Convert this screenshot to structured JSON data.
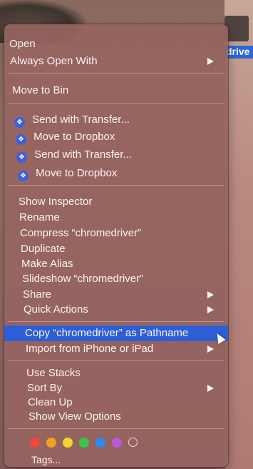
{
  "desktop": {
    "selected_label": "drive"
  },
  "menu": {
    "open": "Open",
    "always_open_with": "Always Open With",
    "move_to_bin": "Move to Bin",
    "dropbox_items": [
      {
        "label": "Send with Transfer..."
      },
      {
        "label": "Move to Dropbox"
      },
      {
        "label": "Send with Transfer..."
      },
      {
        "label": "Move to Dropbox"
      }
    ],
    "show_inspector": "Show Inspector",
    "rename": "Rename",
    "compress": "Compress “chromedriver”",
    "duplicate": "Duplicate",
    "make_alias": "Make Alias",
    "slideshow": "Slideshow “chromedriver”",
    "share": "Share",
    "quick_actions": "Quick Actions",
    "copy_pathname": "Copy “chromedriver” as Pathname",
    "import_iphone": "Import from iPhone or iPad",
    "use_stacks": "Use Stacks",
    "sort_by": "Sort By",
    "clean_up": "Clean Up",
    "show_view_options": "Show View Options",
    "tags_label": "Tags...",
    "tag_colors": [
      "#f0483a",
      "#f4a021",
      "#f6d52b",
      "#37c84a",
      "#2c8bf0",
      "#bc57d8",
      "empty"
    ],
    "highlight_color": "#2c5fd6"
  }
}
